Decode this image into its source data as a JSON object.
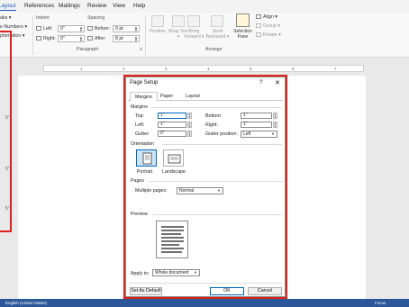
{
  "ribbon": {
    "tabs": [
      {
        "label": "Layout"
      },
      {
        "label": "References"
      },
      {
        "label": "Mailings"
      },
      {
        "label": "Review"
      },
      {
        "label": "View"
      },
      {
        "label": "Help"
      }
    ],
    "left_items": {
      "breaks": "aks ▾",
      "line_numbers": "e Numbers ▾",
      "hyphenation": "phenation ▾"
    },
    "indent": {
      "title": "Indent",
      "left_label": "Left:",
      "left_value": "0\"",
      "right_label": "Right:",
      "right_value": "0\""
    },
    "spacing": {
      "title": "Spacing",
      "before_label": "Before:",
      "before_value": "0 pt",
      "after_label": "After:",
      "after_value": "8 pt"
    },
    "paragraph_group": "Paragraph",
    "arrange": {
      "position": "Position",
      "wrap_text": "Wrap Text ▾",
      "bring_forward": "Bring Forward ▾",
      "send_backward": "Send Backward ▾",
      "selection_pane": "Selection Pane",
      "align": "Align ▾",
      "group": "Group ▾",
      "rotate": "Rotate ▾",
      "group_label": "Arrange"
    }
  },
  "ruler": {
    "marks": [
      "1",
      "2",
      "3",
      "4",
      "5",
      "6",
      "7"
    ]
  },
  "side_marks": [
    "5\"",
    "5\"",
    "5\""
  ],
  "dialog": {
    "title": "Page Setup",
    "help": "?",
    "close": "✕",
    "tabs": [
      "Margins",
      "Paper",
      "Layout"
    ],
    "margins_section": "Margins",
    "top_label": "Top:",
    "top_value": "1\"",
    "bottom_label": "Bottom:",
    "bottom_value": "1\"",
    "left_label": "Left:",
    "left_value": "1\"",
    "right_label": "Right:",
    "right_value": "1\"",
    "gutter_label": "Gutter:",
    "gutter_value": "0\"",
    "gutter_position_label": "Gutter position:",
    "gutter_position_value": "Left",
    "orientation_section": "Orientation",
    "portrait": "Portrait",
    "landscape": "Landscape",
    "pages_section": "Pages",
    "multiple_pages_label": "Multiple pages:",
    "multiple_pages_value": "Normal",
    "preview_section": "Preview",
    "apply_to_label": "Apply to:",
    "apply_to_value": "Whole document",
    "set_default": "Set As Default",
    "ok": "OK",
    "cancel": "Cancel"
  },
  "status": {
    "left": "English (United States)",
    "focus": "Focus"
  }
}
